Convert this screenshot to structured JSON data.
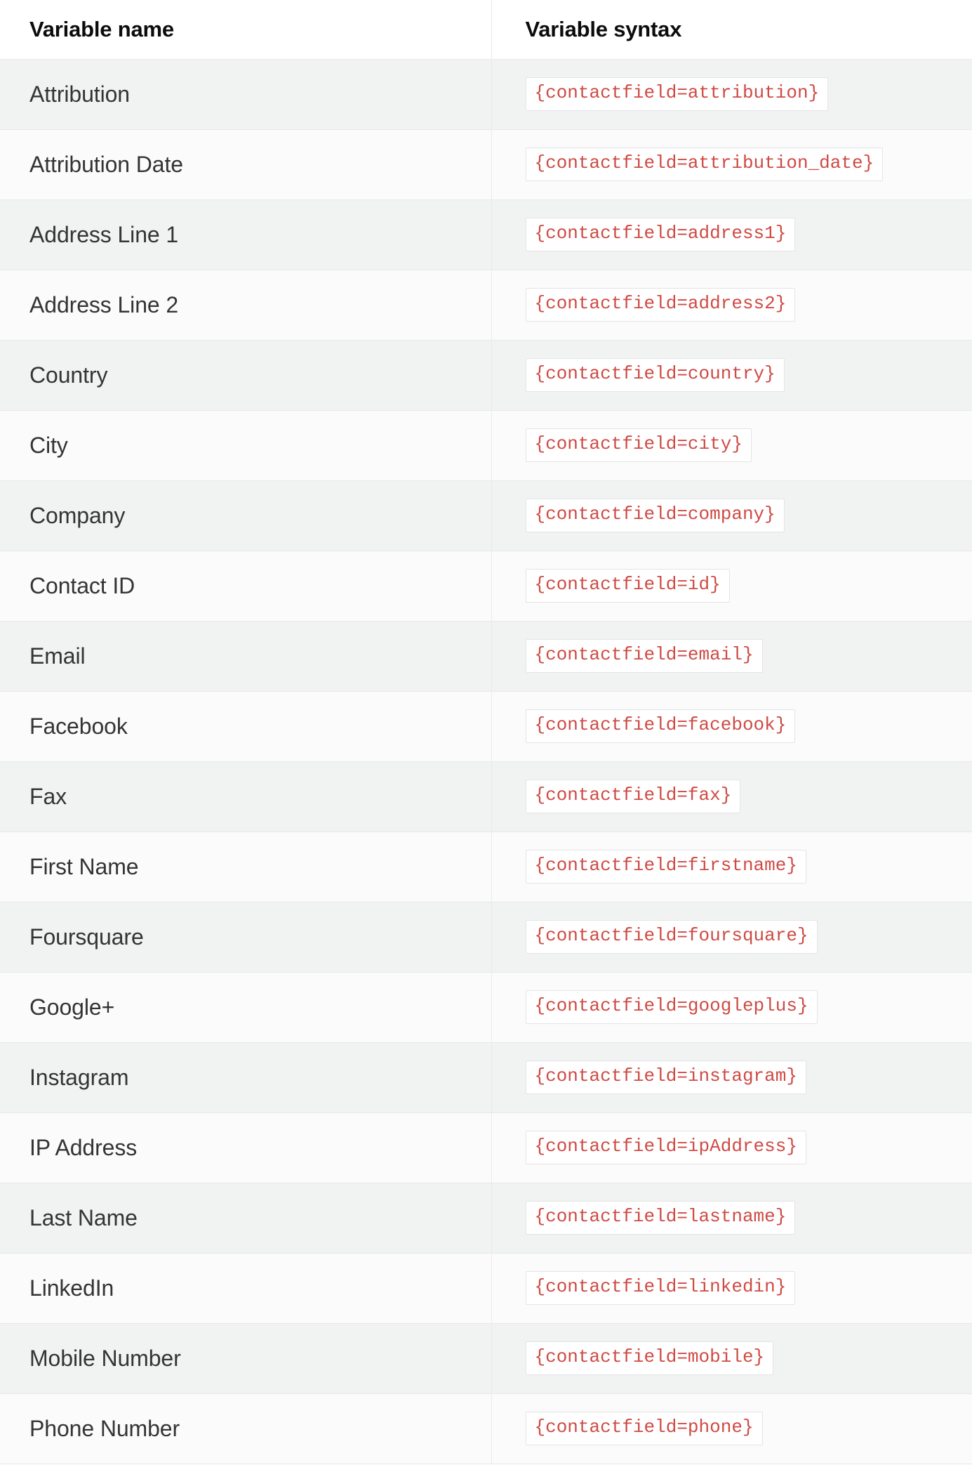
{
  "table": {
    "columns": [
      {
        "key": "name",
        "label": "Variable name"
      },
      {
        "key": "syntax",
        "label": "Variable syntax"
      }
    ],
    "colors": {
      "code_text": "#cf4a44",
      "code_background": "#ffffff",
      "code_border": "#e4e4e4",
      "row_shaded": "#f1f2f2",
      "row_plain": "#fbfbfb",
      "header_text": "#0c0c0c",
      "cell_text": "#343434",
      "divider": "#e7e8e8"
    },
    "rows": [
      {
        "name": "Attribution",
        "syntax": "{contactfield=attribution}"
      },
      {
        "name": "Attribution Date",
        "syntax": "{contactfield=attribution_date}"
      },
      {
        "name": "Address Line 1",
        "syntax": "{contactfield=address1}"
      },
      {
        "name": "Address Line 2",
        "syntax": "{contactfield=address2}"
      },
      {
        "name": "Country",
        "syntax": "{contactfield=country}"
      },
      {
        "name": "City",
        "syntax": "{contactfield=city}"
      },
      {
        "name": "Company",
        "syntax": "{contactfield=company}"
      },
      {
        "name": "Contact ID",
        "syntax": "{contactfield=id}"
      },
      {
        "name": "Email",
        "syntax": "{contactfield=email}"
      },
      {
        "name": "Facebook",
        "syntax": "{contactfield=facebook}"
      },
      {
        "name": "Fax",
        "syntax": "{contactfield=fax}"
      },
      {
        "name": "First Name",
        "syntax": "{contactfield=firstname}"
      },
      {
        "name": "Foursquare",
        "syntax": "{contactfield=foursquare}"
      },
      {
        "name": "Google+",
        "syntax": "{contactfield=googleplus}"
      },
      {
        "name": "Instagram",
        "syntax": "{contactfield=instagram}"
      },
      {
        "name": "IP Address",
        "syntax": "{contactfield=ipAddress}"
      },
      {
        "name": "Last Name",
        "syntax": "{contactfield=lastname}"
      },
      {
        "name": "LinkedIn",
        "syntax": "{contactfield=linkedin}"
      },
      {
        "name": "Mobile Number",
        "syntax": "{contactfield=mobile}"
      },
      {
        "name": "Phone Number",
        "syntax": "{contactfield=phone}"
      }
    ]
  }
}
